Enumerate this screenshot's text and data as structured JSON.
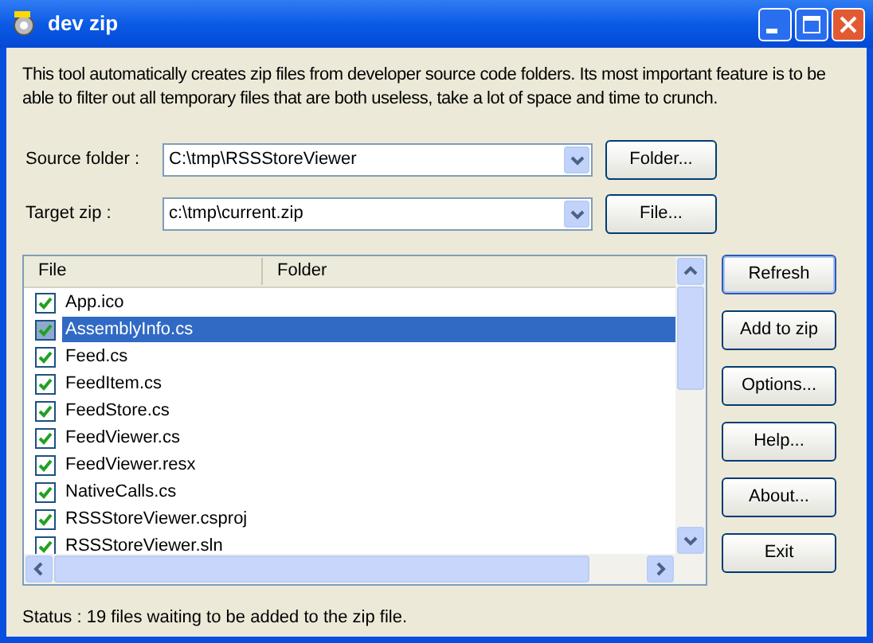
{
  "window": {
    "title": "dev zip"
  },
  "description": "This tool automatically creates zip files from developer source code folders. Its most important feature is to be able to filter out all temporary files that are both useless, take a lot of space and time to crunch.",
  "source": {
    "label": "Source folder :",
    "value": "C:\\tmp\\RSSStoreViewer",
    "button": "Folder..."
  },
  "target": {
    "label": "Target zip :",
    "value": "c:\\tmp\\current.zip",
    "button": "File..."
  },
  "list": {
    "columns": [
      "File",
      "Folder"
    ],
    "rows": [
      {
        "file": "App.ico",
        "checked": true,
        "selected": false
      },
      {
        "file": "AssemblyInfo.cs",
        "checked": true,
        "selected": true
      },
      {
        "file": "Feed.cs",
        "checked": true,
        "selected": false
      },
      {
        "file": "FeedItem.cs",
        "checked": true,
        "selected": false
      },
      {
        "file": "FeedStore.cs",
        "checked": true,
        "selected": false
      },
      {
        "file": "FeedViewer.cs",
        "checked": true,
        "selected": false
      },
      {
        "file": "FeedViewer.resx",
        "checked": true,
        "selected": false
      },
      {
        "file": "NativeCalls.cs",
        "checked": true,
        "selected": false
      },
      {
        "file": "RSSStoreViewer.csproj",
        "checked": true,
        "selected": false
      },
      {
        "file": "RSSStoreViewer.sln",
        "checked": true,
        "selected": false
      }
    ]
  },
  "buttons": [
    {
      "label": "Refresh",
      "default": true
    },
    {
      "label": "Add to zip",
      "default": false
    },
    {
      "label": "Options...",
      "default": false
    },
    {
      "label": "Help...",
      "default": false
    },
    {
      "label": "About...",
      "default": false
    },
    {
      "label": "Exit",
      "default": false
    }
  ],
  "status": "Status : 19 files waiting to be added to the zip file."
}
